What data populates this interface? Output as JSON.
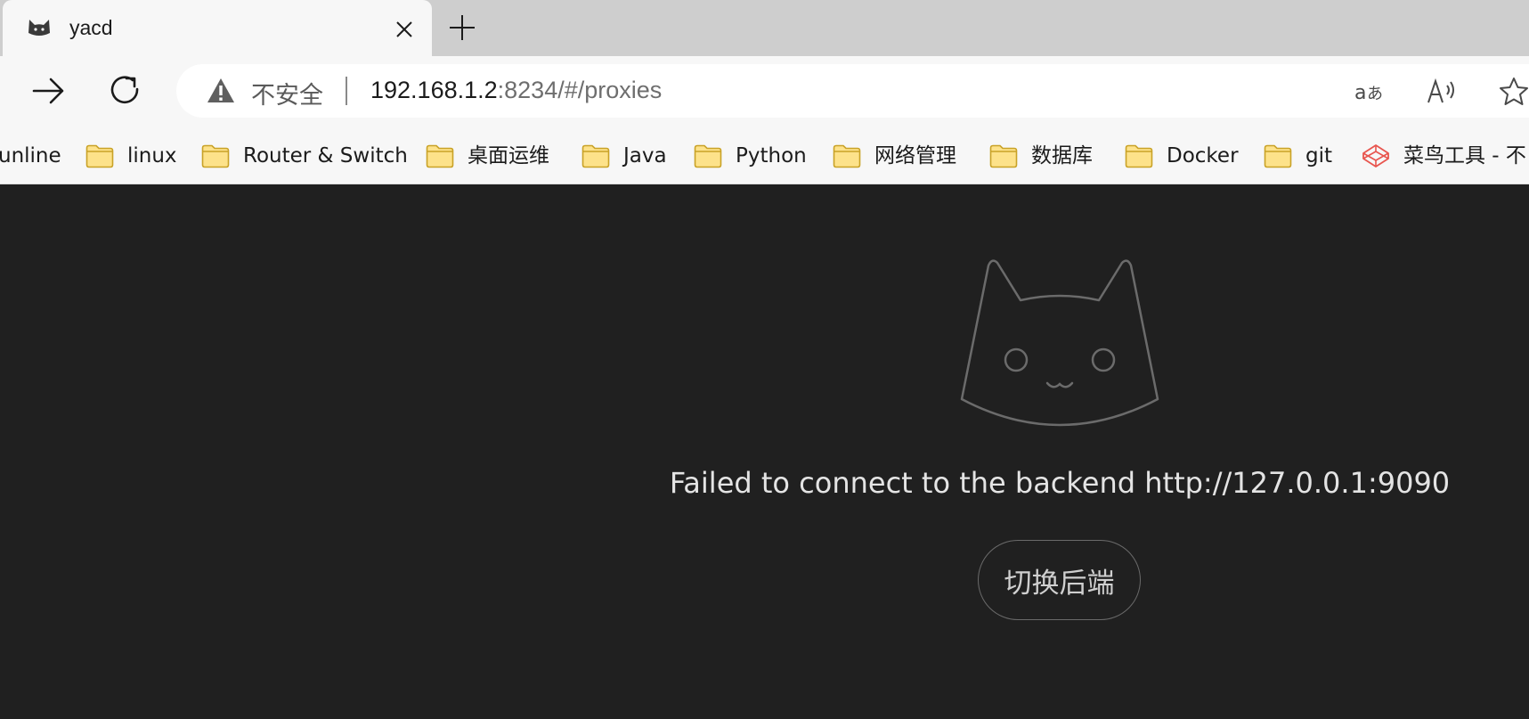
{
  "tab": {
    "title": "yacd"
  },
  "toolbar": {
    "security_label": "不安全",
    "url_host": "192.168.1.2",
    "url_rest": ":8234/#/proxies"
  },
  "bookmarks": [
    {
      "label": "unline",
      "icon": "none"
    },
    {
      "label": "linux",
      "icon": "folder-icon"
    },
    {
      "label": "Router & Switch",
      "icon": "folder-icon"
    },
    {
      "label": "桌面运维",
      "icon": "folder-icon"
    },
    {
      "label": "Java",
      "icon": "folder-icon"
    },
    {
      "label": "Python",
      "icon": "folder-icon"
    },
    {
      "label": "网络管理",
      "icon": "folder-icon"
    },
    {
      "label": "数据库",
      "icon": "folder-icon"
    },
    {
      "label": "Docker",
      "icon": "folder-icon"
    },
    {
      "label": "git",
      "icon": "folder-icon"
    },
    {
      "label": "菜鸟工具 - 不",
      "icon": "codepen-icon"
    }
  ],
  "page": {
    "error_message": "Failed to connect to the backend http://127.0.0.1:9090",
    "switch_backend_label": "切换后端"
  },
  "colors": {
    "page_background": "#202020",
    "folder_fill": "#fde28a",
    "folder_stroke": "#c9a227",
    "codepen_red": "#e8554e"
  }
}
